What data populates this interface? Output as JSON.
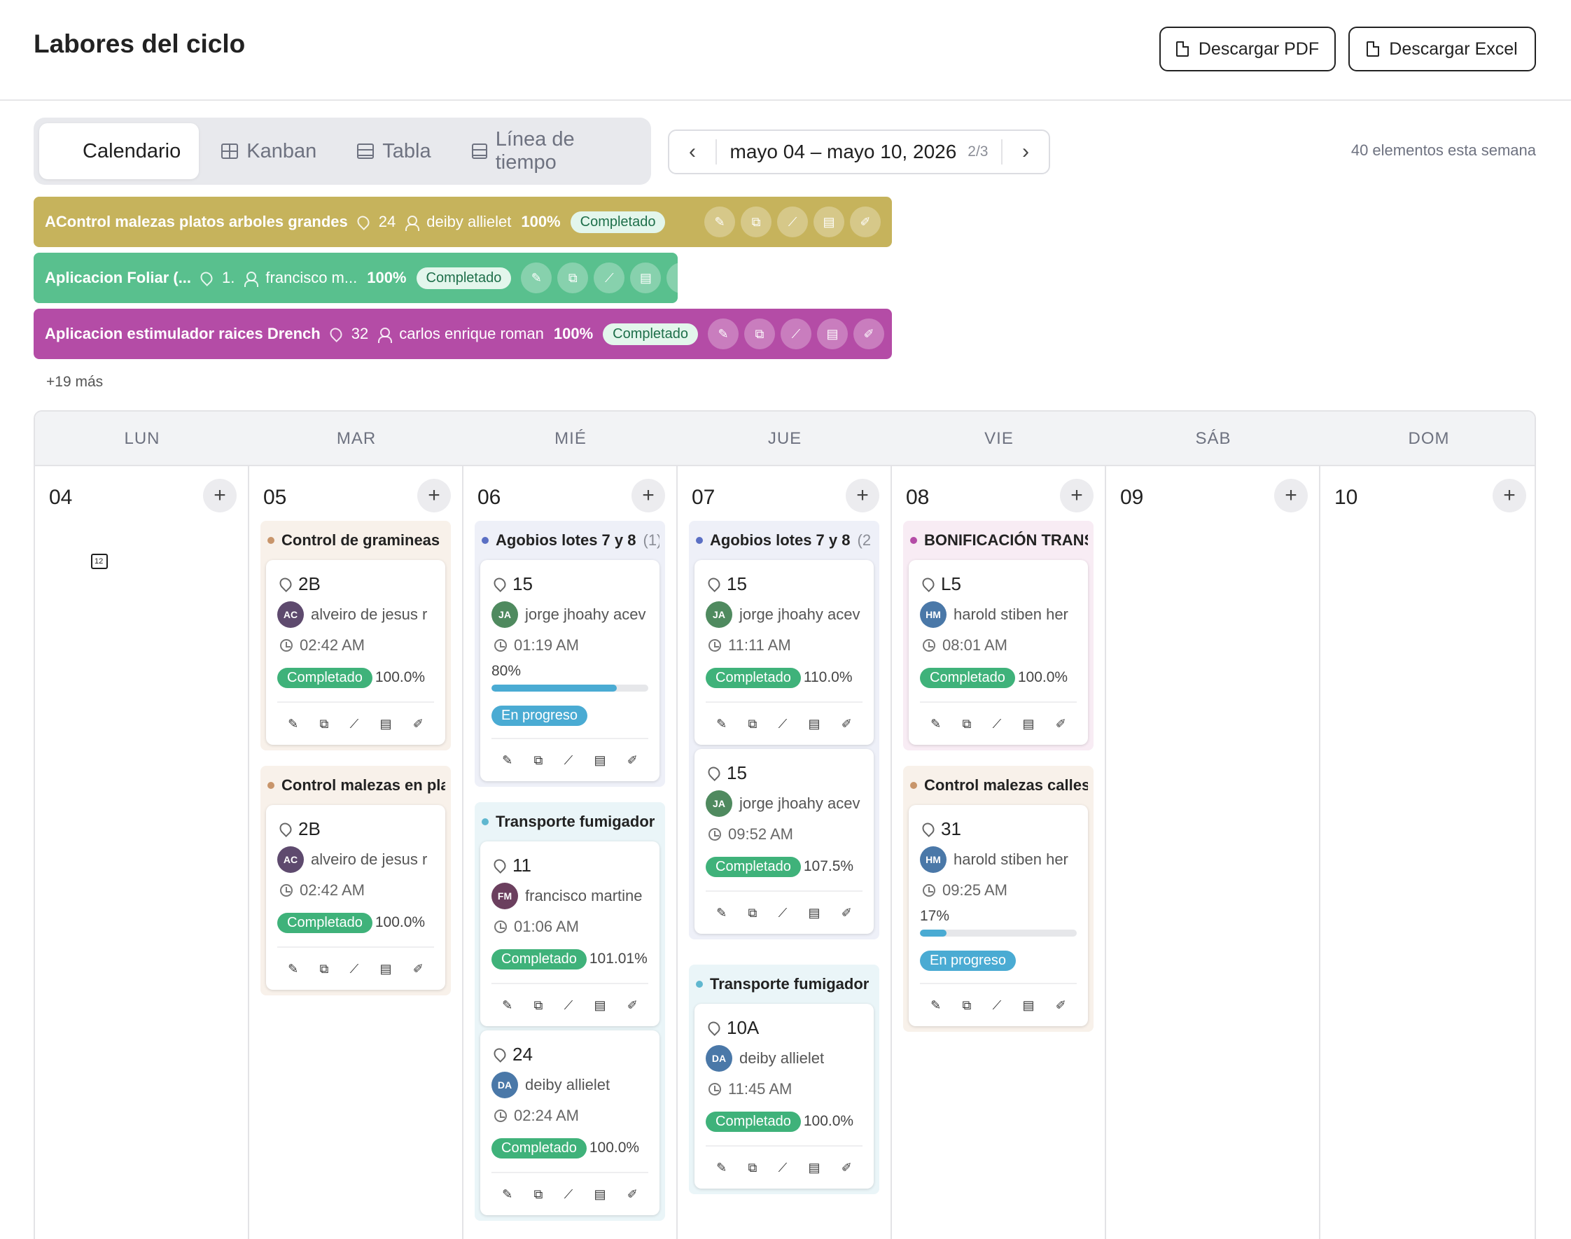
{
  "page": {
    "title": "Labores del ciclo",
    "download_pdf": "Descargar PDF",
    "download_excel": "Descargar Excel"
  },
  "view_tabs": {
    "calendar": "Calendario",
    "kanban": "Kanban",
    "table": "Tabla",
    "timeline": "Línea de tiempo",
    "active": "calendar"
  },
  "week_nav": {
    "prev": "‹",
    "next": "›",
    "range": "mayo 04 – mayo 10, 2026",
    "page": "2/3"
  },
  "week_count": "40 elementos esta semana",
  "banners": [
    {
      "name": "AControl malezas platos arboles grandes",
      "lot": "24",
      "person": "deiby allielet",
      "pct": "100%",
      "status": "Completado",
      "color": "#c6b35c"
    },
    {
      "name": "Aplicacion Foliar (...",
      "lot": "1.",
      "person": "francisco m...",
      "pct": "100%",
      "status": "Completado",
      "color": "#59c08e"
    },
    {
      "name": "Aplicacion estimulador raices Drench",
      "lot": "32",
      "person": "carlos enrique roman",
      "pct": "100%",
      "status": "Completado",
      "color": "#b44ca6"
    }
  ],
  "more": "+19 más",
  "action_icons": [
    "pencil-icon",
    "copy-icon",
    "chart-icon",
    "clipboard-icon",
    "edit-icon"
  ],
  "action_glyphs": [
    "✎",
    "⧉",
    "⟋",
    "▤",
    "✐"
  ],
  "days": [
    {
      "dow": "LUN",
      "num": "04"
    },
    {
      "dow": "MAR",
      "num": "05"
    },
    {
      "dow": "MIÉ",
      "num": "06"
    },
    {
      "dow": "JUE",
      "num": "07"
    },
    {
      "dow": "VIE",
      "num": "08"
    },
    {
      "dow": "SÁB",
      "num": "09"
    },
    {
      "dow": "DOM",
      "num": "10"
    }
  ],
  "add_label": "+",
  "groups": {
    "mar_1": {
      "title": "Control de gramineas",
      "count": "",
      "dot": "#c8956b",
      "bg": "#f8f1ea",
      "cards": [
        {
          "lot": "2B",
          "initials": "AC",
          "avatar": "#5e4a6e",
          "person": "alveiro de jesus r",
          "time": "02:42 AM",
          "status": "Completado",
          "pct": "100.0%"
        }
      ]
    },
    "mar_2": {
      "title": "Control malezas en pla",
      "count": "",
      "dot": "#c8956b",
      "bg": "#f8f1ea",
      "cards": [
        {
          "lot": "2B",
          "initials": "AC",
          "avatar": "#5e4a6e",
          "person": "alveiro de jesus r",
          "time": "02:42 AM",
          "status": "Completado",
          "pct": "100.0%"
        }
      ]
    },
    "mie_1": {
      "title": "Agobios lotes 7 y 8",
      "count": "(1)",
      "dot": "#5a6fc4",
      "bg": "#eef0f8",
      "cards": [
        {
          "lot": "15",
          "initials": "JA",
          "avatar": "#4f8a5f",
          "person": "jorge jhoahy acev",
          "time": "01:19 AM",
          "progress_label": "80%",
          "progress": 0.8,
          "status": "En progreso"
        }
      ]
    },
    "mie_2": {
      "title": "Transporte fumigador",
      "count": "",
      "dot": "#5fb7cf",
      "bg": "#eaf5f8",
      "cards": [
        {
          "lot": "11",
          "initials": "FM",
          "avatar": "#6b3f5e",
          "person": "francisco martine",
          "time": "01:06 AM",
          "status": "Completado",
          "pct": "101.01%"
        },
        {
          "lot": "24",
          "initials": "DA",
          "avatar": "#4a78a8",
          "person": "deiby allielet",
          "time": "02:24 AM",
          "status": "Completado",
          "pct": "100.0%"
        }
      ]
    },
    "jue_1": {
      "title": "Agobios lotes 7 y 8",
      "count": "(2",
      "dot": "#5a6fc4",
      "bg": "#eef0f8",
      "cards": [
        {
          "lot": "15",
          "initials": "JA",
          "avatar": "#4f8a5f",
          "person": "jorge jhoahy acev",
          "time": "11:11 AM",
          "status": "Completado",
          "pct": "110.0%"
        },
        {
          "lot": "15",
          "initials": "JA",
          "avatar": "#4f8a5f",
          "person": "jorge jhoahy acev",
          "time": "09:52 AM",
          "status": "Completado",
          "pct": "107.5%"
        }
      ]
    },
    "jue_2": {
      "title": "Transporte fumigador",
      "count": "",
      "dot": "#5fb7cf",
      "bg": "#eaf5f8",
      "cards": [
        {
          "lot": "10A",
          "initials": "DA",
          "avatar": "#4a78a8",
          "person": "deiby allielet",
          "time": "11:45 AM",
          "status": "Completado",
          "pct": "100.0%"
        }
      ]
    },
    "vie_1": {
      "title": "BONIFICACIÓN TRANS",
      "count": "",
      "dot": "#b44ca6",
      "bg": "#f8ecf4",
      "cards": [
        {
          "lot": "L5",
          "initials": "HM",
          "avatar": "#4a78a8",
          "person": "harold stiben her",
          "time": "08:01 AM",
          "status": "Completado",
          "pct": "100.0%"
        }
      ]
    },
    "vie_2": {
      "title": "Control malezas calles",
      "count": "",
      "dot": "#c8956b",
      "bg": "#f8f1ea",
      "cards": [
        {
          "lot": "31",
          "initials": "HM",
          "avatar": "#4a78a8",
          "person": "harold stiben her",
          "time": "09:25 AM",
          "progress_label": "17%",
          "progress": 0.17,
          "status": "En progreso"
        }
      ]
    }
  }
}
